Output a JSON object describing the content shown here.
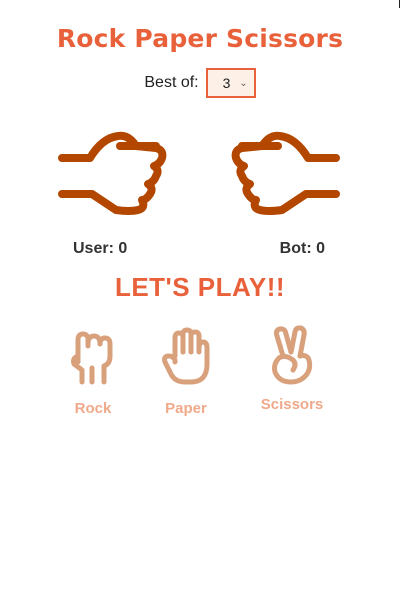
{
  "title": "Rock Paper Scissors",
  "best_of": {
    "label": "Best of:",
    "selected": "3"
  },
  "scores": {
    "user_label": "User: 0",
    "bot_label": "Bot: 0"
  },
  "status": "LET'S PLAY!!",
  "choices": [
    {
      "label": "Rock",
      "icon": "rock-hand-icon"
    },
    {
      "label": "Paper",
      "icon": "paper-hand-icon"
    },
    {
      "label": "Scissors",
      "icon": "scissors-hand-icon"
    }
  ],
  "colors": {
    "accent": "#e8613a",
    "hand_dark": "#b34700",
    "choice_icon": "#d9a07c",
    "choice_label": "#f0a98a"
  }
}
